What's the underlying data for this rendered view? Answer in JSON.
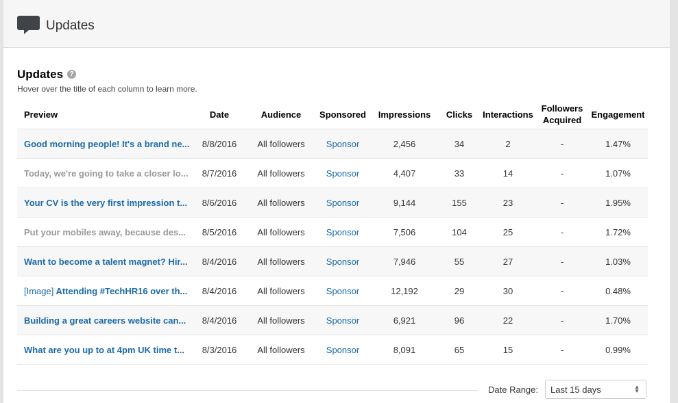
{
  "header": {
    "title": "Updates",
    "icon": "speech-bubble-icon"
  },
  "section": {
    "title": "Updates",
    "help_icon": "?",
    "subtitle": "Hover over the title of each column to learn more."
  },
  "table": {
    "columns": [
      "Preview",
      "Date",
      "Audience",
      "Sponsored",
      "Impressions",
      "Clicks",
      "Interactions",
      "Followers Acquired",
      "Engagement"
    ],
    "rows": [
      {
        "prefix": "",
        "preview": "Good morning people! It's a brand ne...",
        "date": "8/8/2016",
        "audience": "All followers",
        "sponsored": "Sponsor",
        "impressions": "2,456",
        "clicks": "34",
        "interactions": "2",
        "followers": "-",
        "engagement": "1.47%",
        "muted": false
      },
      {
        "prefix": "",
        "preview": "Today, we're going to take a closer lo...",
        "date": "8/7/2016",
        "audience": "All followers",
        "sponsored": "Sponsor",
        "impressions": "4,407",
        "clicks": "33",
        "interactions": "14",
        "followers": "-",
        "engagement": "1.07%",
        "muted": true
      },
      {
        "prefix": "",
        "preview": "Your CV is the very first impression t...",
        "date": "8/6/2016",
        "audience": "All followers",
        "sponsored": "Sponsor",
        "impressions": "9,144",
        "clicks": "155",
        "interactions": "23",
        "followers": "-",
        "engagement": "1.95%",
        "muted": false
      },
      {
        "prefix": "",
        "preview": "Put your mobiles away, because des...",
        "date": "8/5/2016",
        "audience": "All followers",
        "sponsored": "Sponsor",
        "impressions": "7,506",
        "clicks": "104",
        "interactions": "25",
        "followers": "-",
        "engagement": "1.72%",
        "muted": true
      },
      {
        "prefix": "",
        "preview": "Want to become a talent magnet? Hir...",
        "date": "8/4/2016",
        "audience": "All followers",
        "sponsored": "Sponsor",
        "impressions": "7,946",
        "clicks": "55",
        "interactions": "27",
        "followers": "-",
        "engagement": "1.03%",
        "muted": false
      },
      {
        "prefix": "[Image]",
        "preview": "Attending #TechHR16 over th...",
        "date": "8/4/2016",
        "audience": "All followers",
        "sponsored": "Sponsor",
        "impressions": "12,192",
        "clicks": "29",
        "interactions": "30",
        "followers": "-",
        "engagement": "0.48%",
        "muted": false
      },
      {
        "prefix": "",
        "preview": "Building a great careers website can...",
        "date": "8/4/2016",
        "audience": "All followers",
        "sponsored": "Sponsor",
        "impressions": "6,921",
        "clicks": "96",
        "interactions": "22",
        "followers": "-",
        "engagement": "1.70%",
        "muted": false
      },
      {
        "prefix": "",
        "preview": "What are you up to at 4pm UK time t...",
        "date": "8/3/2016",
        "audience": "All followers",
        "sponsored": "Sponsor",
        "impressions": "8,091",
        "clicks": "65",
        "interactions": "15",
        "followers": "-",
        "engagement": "0.99%",
        "muted": false
      }
    ]
  },
  "footer": {
    "date_range_label": "Date Range:",
    "date_range_value": "Last 15 days"
  }
}
